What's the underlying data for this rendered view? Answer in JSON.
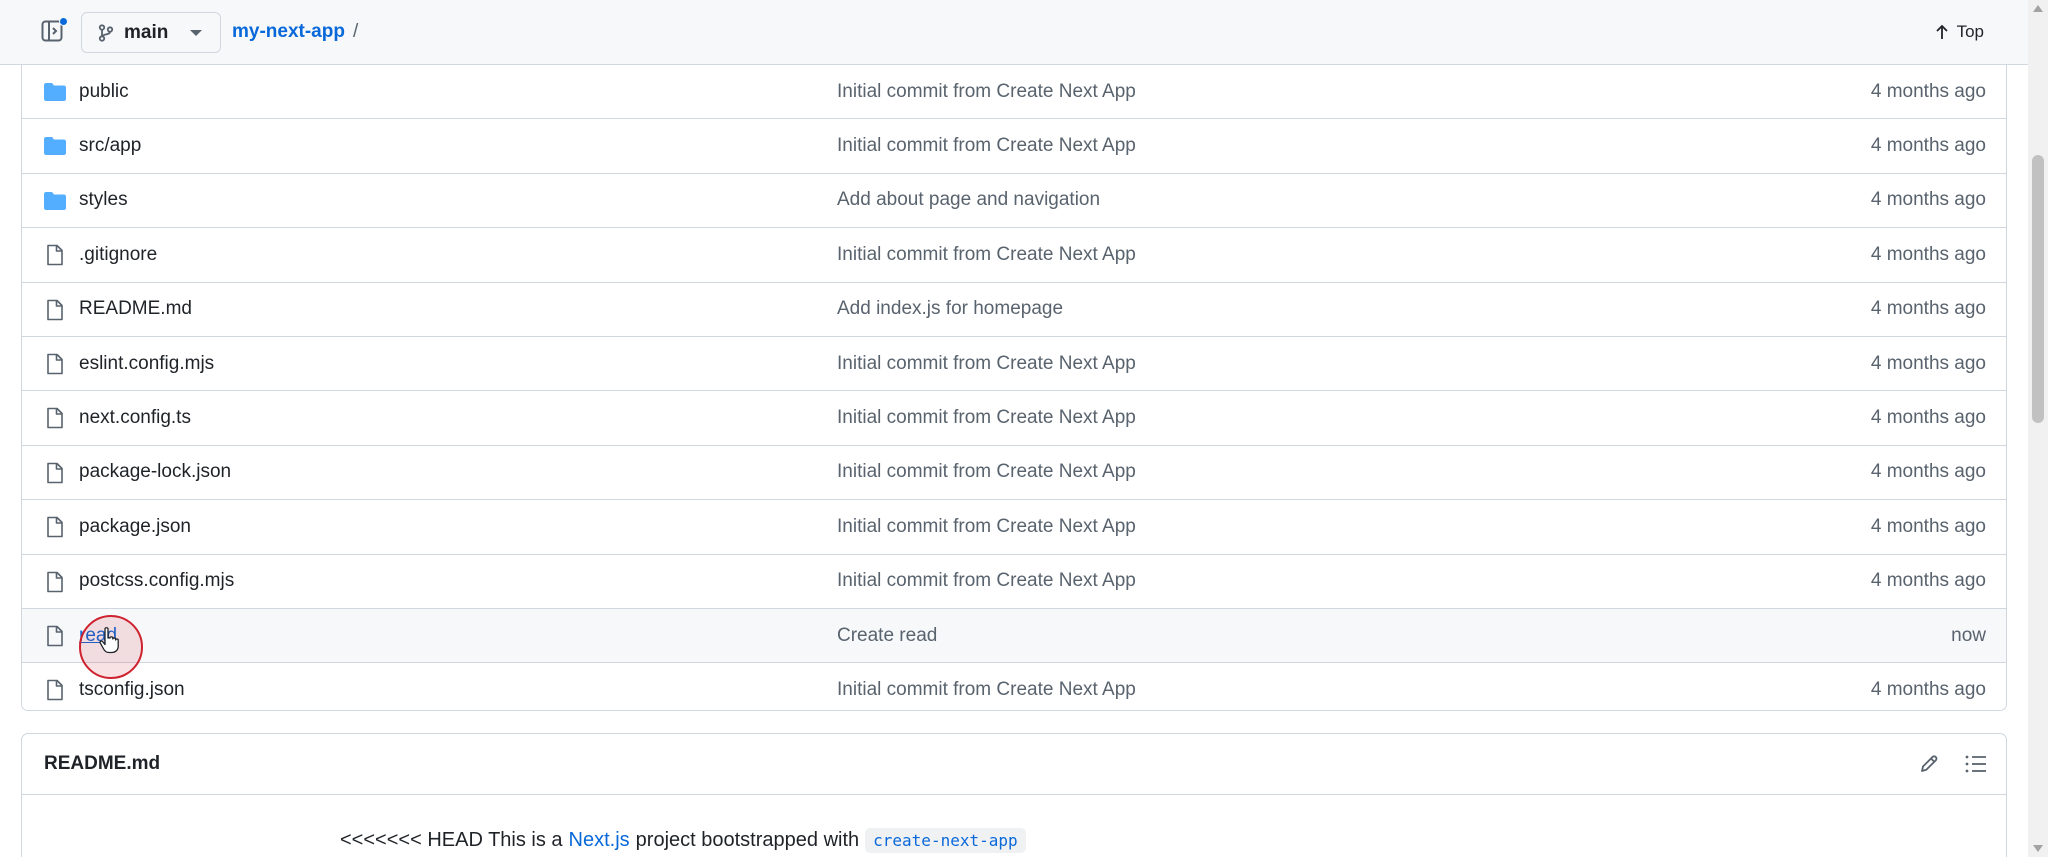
{
  "header": {
    "branch": "main",
    "repo": "my-next-app",
    "separator": "/",
    "top_label": "Top"
  },
  "files": [
    {
      "name": "public",
      "type": "folder",
      "message": "Initial commit from Create Next App",
      "age": "4 months ago"
    },
    {
      "name": "src/app",
      "type": "folder",
      "message": "Initial commit from Create Next App",
      "age": "4 months ago"
    },
    {
      "name": "styles",
      "type": "folder",
      "message": "Add about page and navigation",
      "age": "4 months ago"
    },
    {
      "name": ".gitignore",
      "type": "file",
      "message": "Initial commit from Create Next App",
      "age": "4 months ago"
    },
    {
      "name": "README.md",
      "type": "file",
      "message": "Add index.js for homepage",
      "age": "4 months ago"
    },
    {
      "name": "eslint.config.mjs",
      "type": "file",
      "message": "Initial commit from Create Next App",
      "age": "4 months ago"
    },
    {
      "name": "next.config.ts",
      "type": "file",
      "message": "Initial commit from Create Next App",
      "age": "4 months ago"
    },
    {
      "name": "package-lock.json",
      "type": "file",
      "message": "Initial commit from Create Next App",
      "age": "4 months ago"
    },
    {
      "name": "package.json",
      "type": "file",
      "message": "Initial commit from Create Next App",
      "age": "4 months ago"
    },
    {
      "name": "postcss.config.mjs",
      "type": "file",
      "message": "Initial commit from Create Next App",
      "age": "4 months ago"
    },
    {
      "name": "read",
      "type": "file",
      "message": "Create read",
      "age": "now"
    },
    {
      "name": "tsconfig.json",
      "type": "file",
      "message": "Initial commit from Create Next App",
      "age": "4 months ago"
    }
  ],
  "readme": {
    "title": "README.md",
    "text_before": "<<<<<<< HEAD This is a",
    "link_text": "Next.js",
    "text_middle": "project bootstrapped with",
    "code_text": "create-next-app"
  },
  "colors": {
    "accent": "#0969da",
    "folder": "#54aeff",
    "muted": "#59636e",
    "cursor_ring": "#cf222e"
  }
}
